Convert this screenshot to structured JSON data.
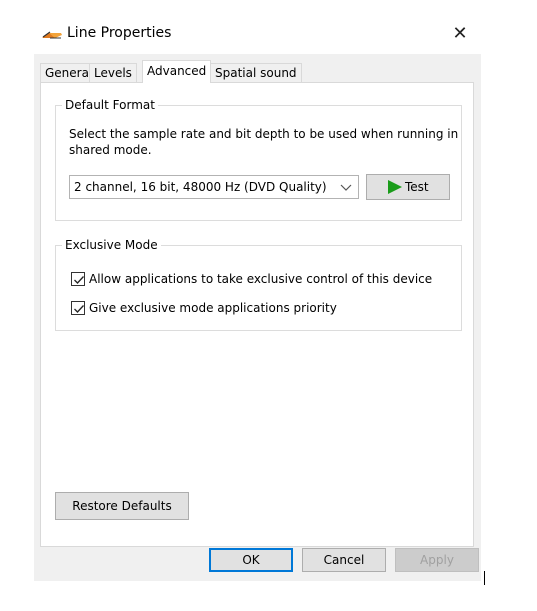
{
  "window": {
    "title": "Line Properties",
    "close_glyph": "✕",
    "icon": "speaker-line-icon"
  },
  "tabs": [
    {
      "label": "General",
      "active": false
    },
    {
      "label": "Levels",
      "active": false
    },
    {
      "label": "Advanced",
      "active": true
    },
    {
      "label": "Spatial sound",
      "active": false
    }
  ],
  "default_format": {
    "legend": "Default Format",
    "description": "Select the sample rate and bit depth to be used when running in shared mode.",
    "select_value": "2 channel, 16 bit, 48000 Hz (DVD Quality)",
    "test_label": "Test",
    "test_icon": "play-icon",
    "test_icon_color": "#1a9c1a"
  },
  "exclusive_mode": {
    "legend": "Exclusive Mode",
    "options": [
      {
        "label": "Allow applications to take exclusive control of this device",
        "checked": true
      },
      {
        "label": "Give exclusive mode applications priority",
        "checked": true
      }
    ]
  },
  "restore_defaults_label": "Restore Defaults",
  "footer": {
    "ok_label": "OK",
    "cancel_label": "Cancel",
    "apply_label": "Apply",
    "apply_enabled": false
  },
  "colors": {
    "accent": "#0078d7",
    "dialog_background": "#f0f0f0",
    "panel_background": "#ffffff"
  }
}
